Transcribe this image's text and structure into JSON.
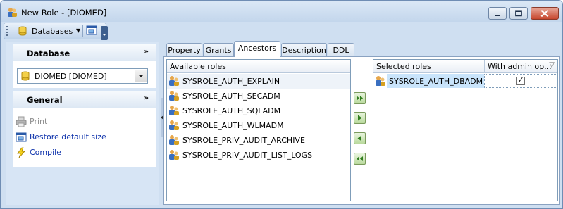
{
  "window": {
    "title": "New Role - [DIOMED]"
  },
  "toolbar": {
    "database_label": "Databases"
  },
  "left_panel": {
    "database_group": {
      "title": "Database",
      "selected": "DIOMED [DIOMED]"
    },
    "general_group": {
      "title": "General",
      "actions": [
        {
          "label": "Print",
          "enabled": false
        },
        {
          "label": "Restore default size",
          "enabled": true
        },
        {
          "label": "Compile",
          "enabled": true
        }
      ]
    }
  },
  "tabs": [
    {
      "label": "Property"
    },
    {
      "label": "Grants"
    },
    {
      "label": "Ancestors",
      "active": true
    },
    {
      "label": "Description"
    },
    {
      "label": "DDL"
    }
  ],
  "available_roles": {
    "header": "Available roles",
    "rows": [
      "SYSROLE_AUTH_EXPLAIN",
      "SYSROLE_AUTH_SECADM",
      "SYSROLE_AUTH_SQLADM",
      "SYSROLE_AUTH_WLMADM",
      "SYSROLE_PRIV_AUDIT_ARCHIVE",
      "SYSROLE_PRIV_AUDIT_LIST_LOGS"
    ]
  },
  "selected_roles": {
    "header_role": "Selected roles",
    "header_admin": "With admin op...",
    "rows": [
      {
        "role": "SYSROLE_AUTH_DBADM",
        "with_admin": true
      }
    ]
  },
  "colors": {
    "window_bg": "#cfdff1",
    "panel_bg": "#d7e5f5",
    "link": "#0a2faa",
    "selection": "#c9e4fb"
  }
}
